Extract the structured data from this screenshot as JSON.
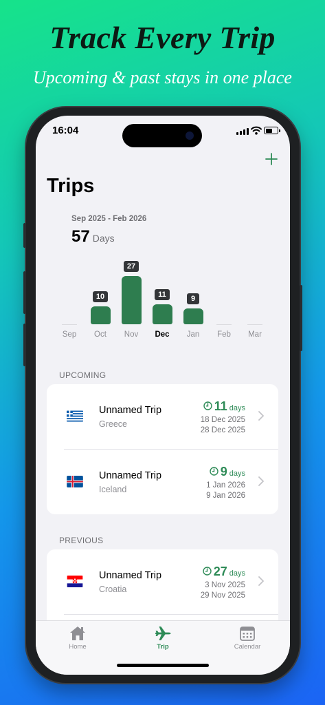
{
  "promo": {
    "headline": "Track Every Trip",
    "subheadline": "Upcoming & past stays in one place"
  },
  "status_bar": {
    "time": "16:04"
  },
  "header": {
    "title": "Trips",
    "add_icon": "plus-icon"
  },
  "summary": {
    "date_range": "Sep 2025 - Feb 2026",
    "total_value": "57",
    "total_unit": "Days"
  },
  "chart_data": {
    "type": "bar",
    "categories": [
      "Sep",
      "Oct",
      "Nov",
      "Dec",
      "Jan",
      "Feb",
      "Mar"
    ],
    "values": [
      0,
      10,
      27,
      11,
      9,
      0,
      0
    ],
    "selected": "Dec",
    "accent_color": "#2e7d4f"
  },
  "sections": {
    "upcoming_label": "UPCOMING",
    "previous_label": "PREVIOUS"
  },
  "upcoming": [
    {
      "name": "Unnamed Trip",
      "country": "Greece",
      "flag": "greece-flag",
      "duration": "11",
      "unit": "days",
      "start": "18 Dec 2025",
      "end": "28 Dec 2025"
    },
    {
      "name": "Unnamed Trip",
      "country": "Iceland",
      "flag": "iceland-flag",
      "duration": "9",
      "unit": "days",
      "start": "1 Jan 2026",
      "end": "9 Jan 2026"
    }
  ],
  "previous": [
    {
      "name": "Unnamed Trip",
      "country": "Croatia",
      "flag": "croatia-flag",
      "duration": "27",
      "unit": "days",
      "start": "3 Nov 2025",
      "end": "29 Nov 2025"
    }
  ],
  "tabs": [
    {
      "label": "Home",
      "icon": "house-icon"
    },
    {
      "label": "Trip",
      "icon": "airplane-icon",
      "active": true
    },
    {
      "label": "Calendar",
      "icon": "calendar-icon"
    }
  ],
  "colors": {
    "accent": "#2e8b57",
    "background_top": "#16e38a",
    "background_bottom": "#1b64f4"
  }
}
